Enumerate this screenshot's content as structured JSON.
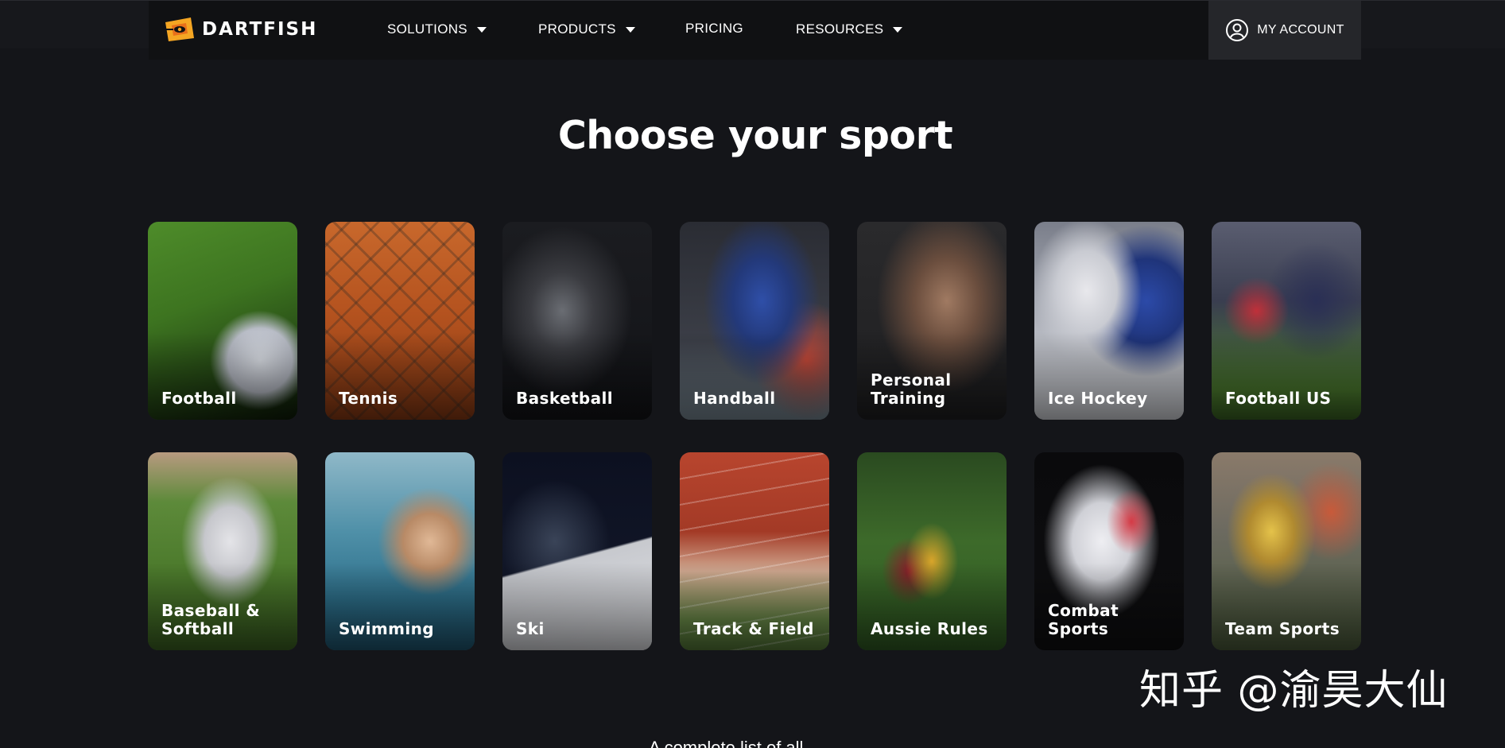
{
  "brand": {
    "name": "DARTFISH",
    "logo_accent": "#f5a623"
  },
  "nav": {
    "items": [
      {
        "label": "SOLUTIONS",
        "dropdown": true
      },
      {
        "label": "PRODUCTS",
        "dropdown": true
      },
      {
        "label": "PRICING",
        "dropdown": false
      },
      {
        "label": "RESOURCES",
        "dropdown": true
      }
    ],
    "account_label": "MY ACCOUNT"
  },
  "page": {
    "heading": "Choose your sport",
    "bottom_text": "A complete list of all sports"
  },
  "sports": [
    {
      "label": "Football",
      "icon": "football-photo"
    },
    {
      "label": "Tennis",
      "icon": "tennis-photo"
    },
    {
      "label": "Basketball",
      "icon": "basketball-photo"
    },
    {
      "label": "Handball",
      "icon": "handball-photo"
    },
    {
      "label": "Personal Training",
      "icon": "training-photo"
    },
    {
      "label": "Ice Hockey",
      "icon": "ice-hockey-photo"
    },
    {
      "label": "Football US",
      "icon": "american-football-photo"
    },
    {
      "label": "Baseball & Softball",
      "icon": "baseball-photo"
    },
    {
      "label": "Swimming",
      "icon": "swimming-photo"
    },
    {
      "label": "Ski",
      "icon": "ski-photo"
    },
    {
      "label": "Track & Field",
      "icon": "track-photo"
    },
    {
      "label": "Aussie Rules",
      "icon": "aussie-rules-photo"
    },
    {
      "label": "Combat Sports",
      "icon": "combat-photo"
    },
    {
      "label": "Team Sports",
      "icon": "team-sports-photo"
    }
  ],
  "watermark": "知乎 @渝昊大仙"
}
